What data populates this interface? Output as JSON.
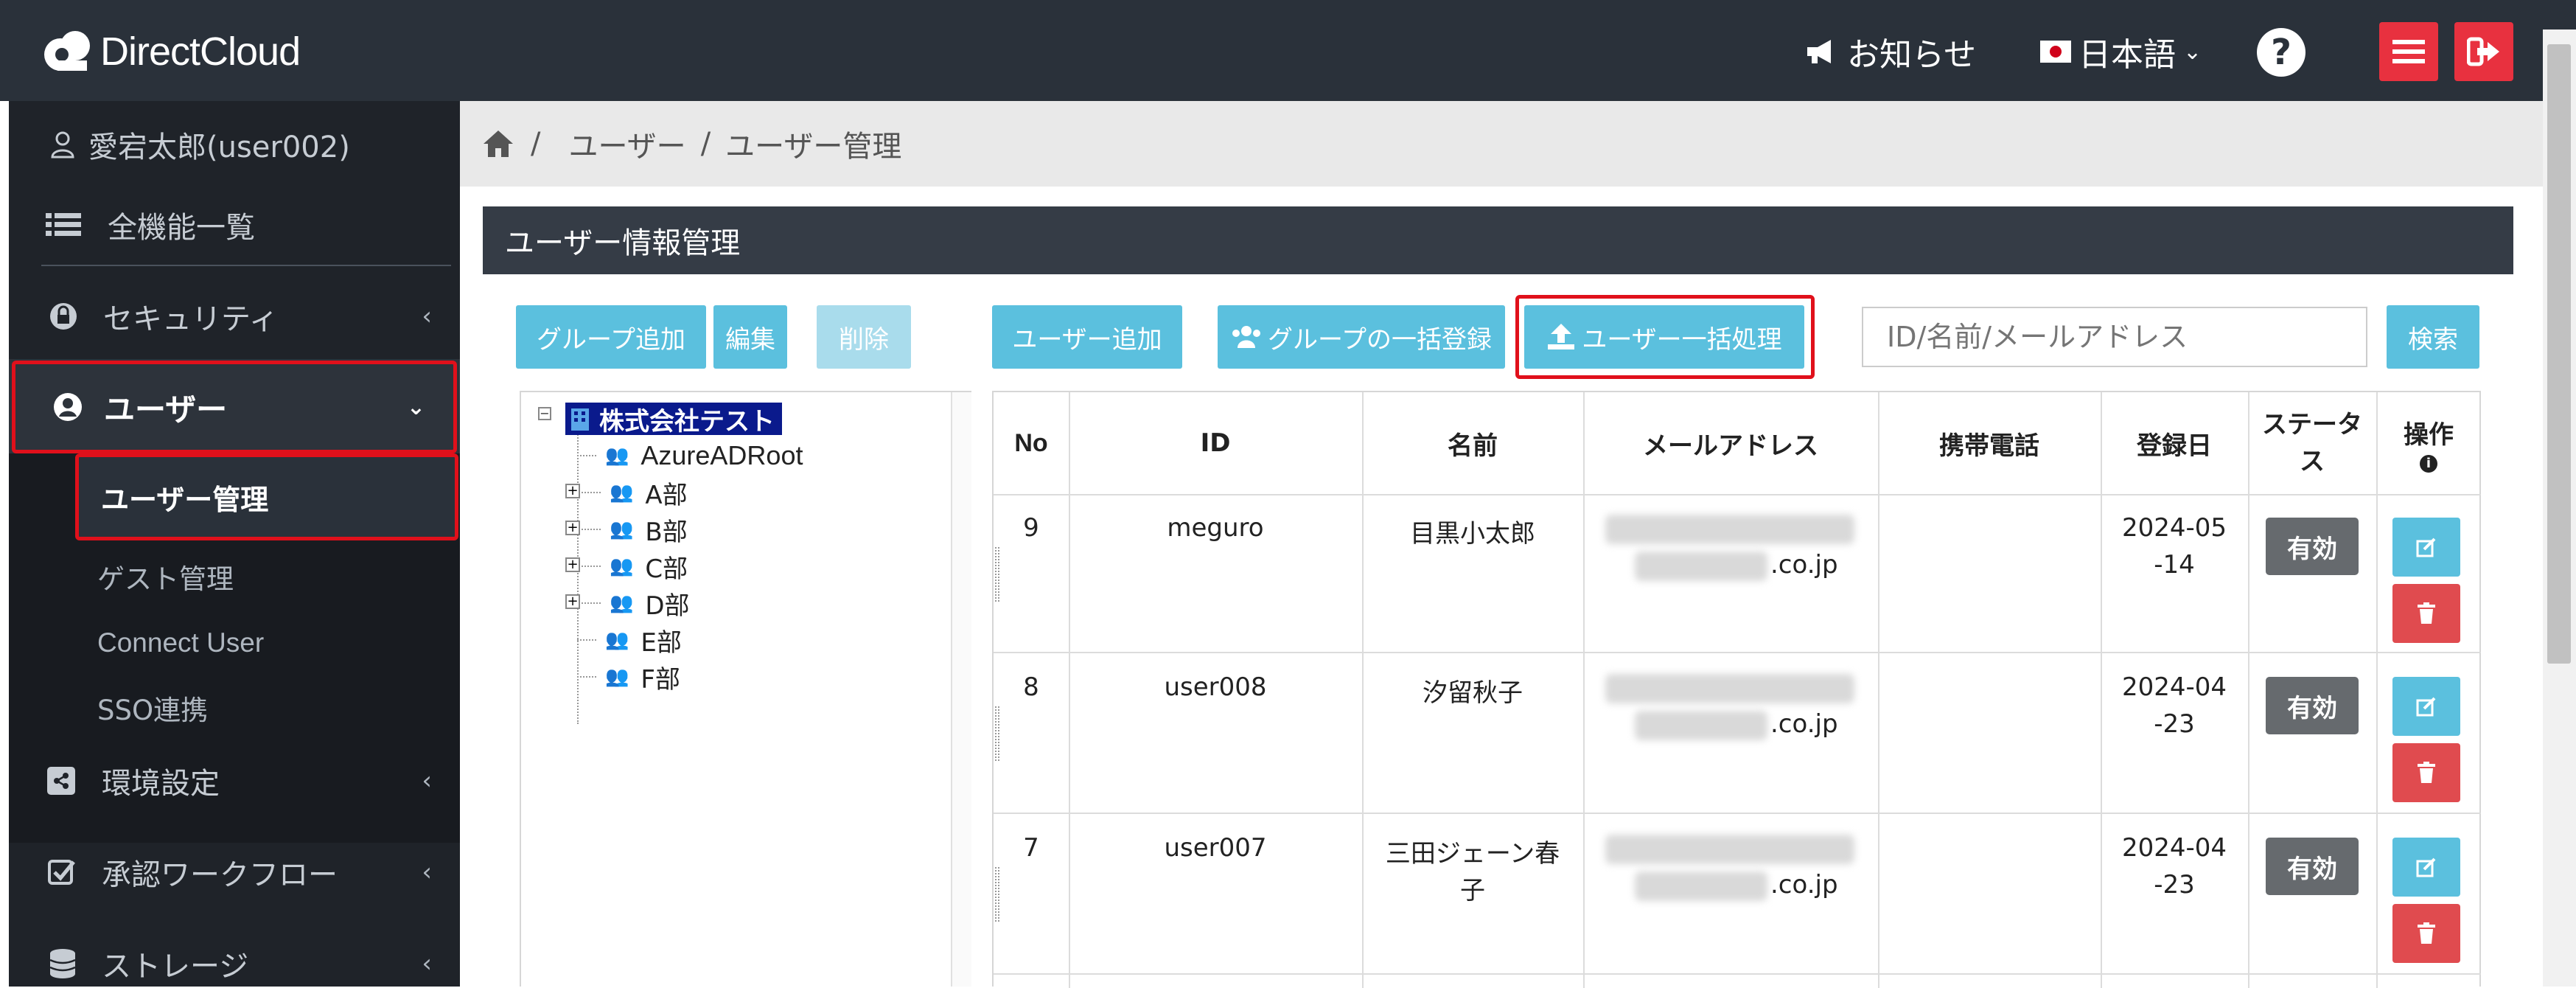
{
  "header": {
    "logo_text": "DirectCloud",
    "notice_label": "お知らせ",
    "language_label": "日本語",
    "help_icon": "question-circle-icon",
    "menu_icon": "hamburger-icon",
    "logout_icon": "logout-icon"
  },
  "sidebar": {
    "user_name": "愛宕太郎(user002)",
    "items": [
      {
        "label": "全機能一覧",
        "icon": "list-icon"
      },
      {
        "label": "セキュリティ",
        "icon": "lock-icon"
      },
      {
        "label": "ユーザー",
        "icon": "user-circle-icon"
      },
      {
        "label": "ユーザー管理"
      },
      {
        "label": "ゲスト管理"
      },
      {
        "label": "Connect User"
      },
      {
        "label": "SSO連携"
      },
      {
        "label": "環境設定",
        "icon": "share-icon"
      },
      {
        "label": "承認ワークフロー",
        "icon": "check-square-icon"
      },
      {
        "label": "ストレージ",
        "icon": "database-icon"
      }
    ]
  },
  "breadcrumb": {
    "home_icon": "home-icon",
    "sep": "/",
    "level1": "ユーザー",
    "level2": "ユーザー管理"
  },
  "panel": {
    "title": "ユーザー情報管理"
  },
  "toolbar": {
    "group_add": "グループ追加",
    "edit": "編集",
    "delete": "削除",
    "user_add": "ユーザー追加",
    "group_bulk": "グループの一括登録",
    "user_bulk": "ユーザー一括処理",
    "search_placeholder": "ID/名前/メールアドレス",
    "search_button": "検索"
  },
  "tree": {
    "root": "株式会社テスト",
    "children": [
      "AzureADRoot",
      "A部",
      "B部",
      "C部",
      "D部",
      "E部",
      "F部"
    ]
  },
  "table": {
    "headers": {
      "no": "No",
      "id": "ID",
      "name": "名前",
      "email": "メールアドレス",
      "mobile": "携帯電話",
      "registered": "登録日",
      "status": "ステータス",
      "action": "操作"
    },
    "rows": [
      {
        "no": "9",
        "id": "meguro",
        "name": "目黒小太郎",
        "email_suffix": ".co.jp",
        "date1": "2024-05",
        "date2": "-14",
        "status": "有効"
      },
      {
        "no": "8",
        "id": "user008",
        "name": "汐留秋子",
        "email_suffix": ".co.jp",
        "date1": "2024-04",
        "date2": "-23",
        "status": "有効"
      },
      {
        "no": "7",
        "id": "user007",
        "name1": "三田ジェーン春",
        "name2": "子",
        "email_suffix": ".co.jp",
        "date1": "2024-04",
        "date2": "-23",
        "status": "有効"
      }
    ]
  },
  "colors": {
    "topbar": "#2a313a",
    "sidebar": "#1f2329",
    "accent": "#5bc0de",
    "danger": "#e8313f",
    "highlight_box": "#e0101b"
  }
}
